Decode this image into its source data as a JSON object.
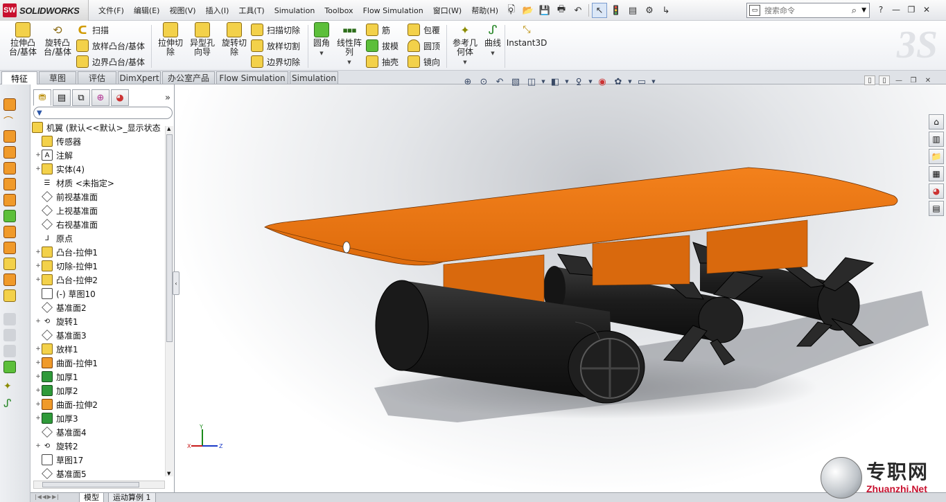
{
  "app": {
    "logo_text": "SOLIDWORKS",
    "logo_badge": "SW"
  },
  "menu": [
    "文件(F)",
    "编辑(E)",
    "视图(V)",
    "插入(I)",
    "工具(T)",
    "Simulation",
    "Toolbox",
    "Flow Simulation",
    "窗口(W)",
    "帮助(H)"
  ],
  "search": {
    "placeholder": "搜索命令"
  },
  "commands": {
    "extrude_boss": "拉伸凸\n台/基体",
    "revolve_boss": "旋转凸\n台/基体",
    "sweep": "扫描",
    "loft_boss": "放样凸台/基体",
    "boundary_boss": "边界凸台/基体",
    "extrude_cut": "拉伸切\n除",
    "hole_wizard": "异型孔\n向导",
    "revolve_cut": "旋转切\n除",
    "swept_cut": "扫描切除",
    "lofted_cut": "放样切割",
    "boundary_cut": "边界切除",
    "fillet": "圆角",
    "linear_pattern": "线性阵\n列",
    "rib": "筋",
    "draft": "拔模",
    "shell": "抽壳",
    "wrap": "包覆",
    "dome": "圆顶",
    "mirror": "镜向",
    "ref_geometry": "参考几\n何体",
    "curves": "曲线",
    "instant3d": "Instant3D"
  },
  "tabs": [
    "特征",
    "草图",
    "评估",
    "DimXpert",
    "办公室产品",
    "Flow Simulation",
    "Simulation"
  ],
  "tree": {
    "root": "机翼 (默认<<默认>_显示状态",
    "items": [
      {
        "label": "传感器",
        "icon": "sensor-icon",
        "exp": ""
      },
      {
        "label": "注解",
        "icon": "annotation-icon",
        "exp": "+"
      },
      {
        "label": "实体(4)",
        "icon": "solid-bodies-icon",
        "exp": "+"
      },
      {
        "label": "材质 <未指定>",
        "icon": "material-icon",
        "exp": ""
      },
      {
        "label": "前视基准面",
        "icon": "plane-icon",
        "exp": ""
      },
      {
        "label": "上视基准面",
        "icon": "plane-icon",
        "exp": ""
      },
      {
        "label": "右视基准面",
        "icon": "plane-icon",
        "exp": ""
      },
      {
        "label": "原点",
        "icon": "origin-icon",
        "exp": ""
      },
      {
        "label": "凸台-拉伸1",
        "icon": "boss-extrude-icon",
        "exp": "+"
      },
      {
        "label": "切除-拉伸1",
        "icon": "cut-extrude-icon",
        "exp": "+"
      },
      {
        "label": "凸台-拉伸2",
        "icon": "boss-extrude-icon",
        "exp": "+"
      },
      {
        "label": "(-) 草图10",
        "icon": "sketch-icon",
        "exp": ""
      },
      {
        "label": "基准面2",
        "icon": "plane-icon",
        "exp": ""
      },
      {
        "label": "旋转1",
        "icon": "revolve-icon",
        "exp": "+"
      },
      {
        "label": "基准面3",
        "icon": "plane-icon",
        "exp": ""
      },
      {
        "label": "放样1",
        "icon": "loft-icon",
        "exp": "+"
      },
      {
        "label": "曲面-拉伸1",
        "icon": "surface-extrude-icon",
        "exp": "+"
      },
      {
        "label": "加厚1",
        "icon": "thicken-icon",
        "exp": "+"
      },
      {
        "label": "加厚2",
        "icon": "thicken-icon",
        "exp": "+"
      },
      {
        "label": "曲面-拉伸2",
        "icon": "surface-extrude-icon",
        "exp": "+"
      },
      {
        "label": "加厚3",
        "icon": "thicken-icon",
        "exp": "+"
      },
      {
        "label": "基准面4",
        "icon": "plane-icon",
        "exp": ""
      },
      {
        "label": "旋转2",
        "icon": "revolve-icon",
        "exp": "+"
      },
      {
        "label": "草图17",
        "icon": "sketch-icon",
        "exp": ""
      },
      {
        "label": "基准面5",
        "icon": "plane-icon",
        "exp": ""
      }
    ]
  },
  "bottom_tabs": [
    "模型",
    "运动算例 1"
  ],
  "triad": {
    "x": "X",
    "y": "Y",
    "z": "Z"
  },
  "watermark": {
    "cn": "专职网",
    "en": "Zhuanzhi.Net"
  },
  "colors": {
    "wing": "#e8730f",
    "body": "#1e1e1e",
    "accent": "#c8102e"
  }
}
